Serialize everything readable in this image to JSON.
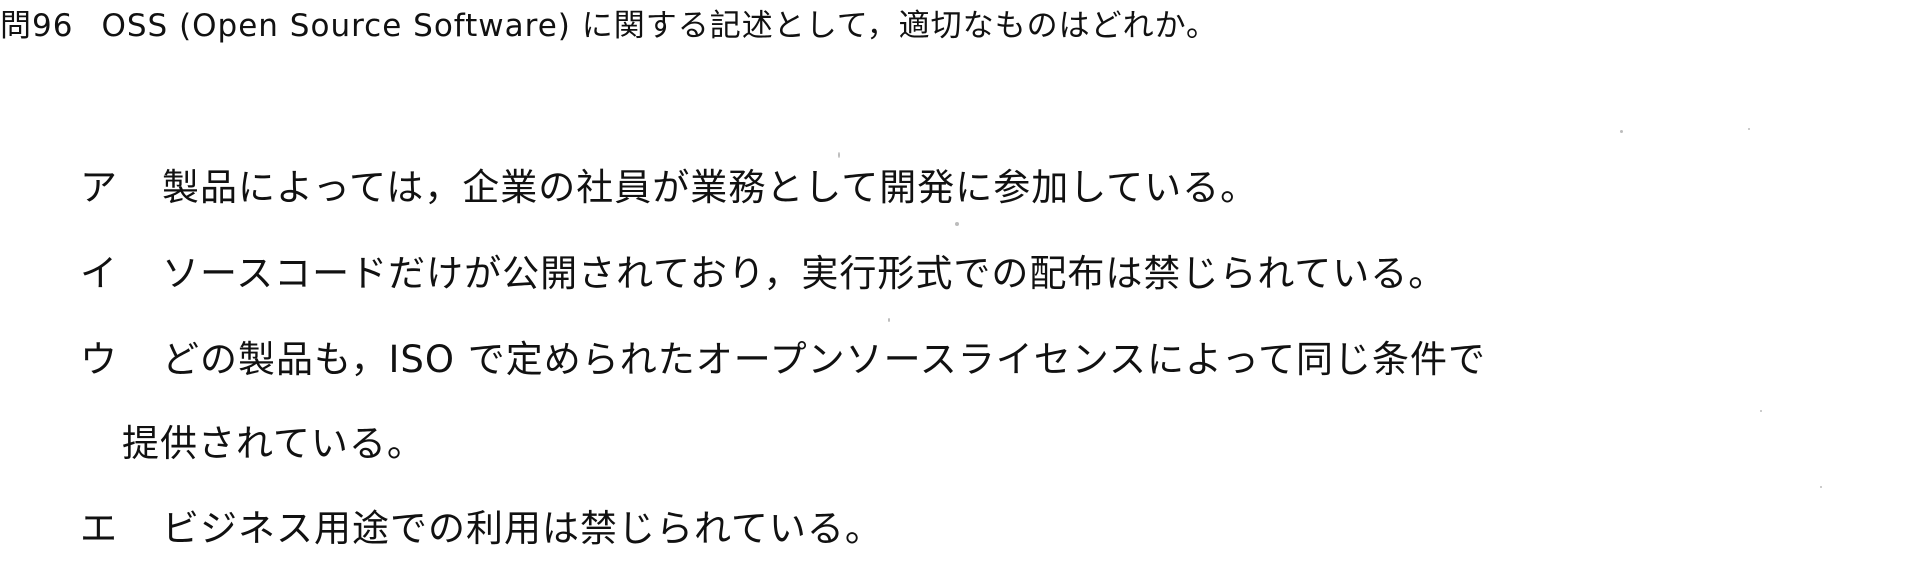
{
  "question": {
    "number": "問96",
    "text": "OSS (Open Source Software) に関する記述として，適切なものはどれか。"
  },
  "choices": [
    {
      "mark": "ア",
      "text": "製品によっては，企業の社員が業務として開発に参加している。"
    },
    {
      "mark": "イ",
      "text": "ソースコードだけが公開されており，実行形式での配布は禁じられている。"
    },
    {
      "mark": "ウ",
      "text": "どの製品も，ISO で定められたオープンソースライセンスによって同じ条件で",
      "continuation": "提供されている。"
    },
    {
      "mark": "エ",
      "text": "ビジネス用途での利用は禁じられている。"
    }
  ]
}
